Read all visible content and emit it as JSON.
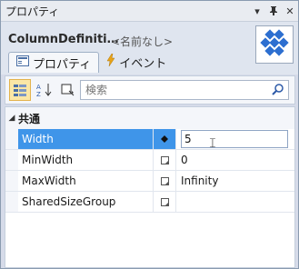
{
  "window": {
    "title": "プロパティ",
    "buttons": [
      "▾",
      "📌",
      "✕"
    ]
  },
  "header": {
    "object_name": "ColumnDefiniti…",
    "name_placeholder": "<名前なし>",
    "logo_icon": "cube-logo-icon"
  },
  "tabs": [
    {
      "label": "プロパティ",
      "icon": "property-sheet-icon",
      "active": true
    },
    {
      "label": "イベント",
      "icon": "lightning-icon",
      "active": false
    }
  ],
  "toolbar": {
    "sort_category_icon": "categorized-icon",
    "sort_alpha_icon": "alphabetical-sort-icon",
    "filter_icon": "filter-icon",
    "search_placeholder": "検索",
    "search_icon": "search-icon"
  },
  "category": {
    "name": "共通",
    "expanded": true
  },
  "properties": [
    {
      "name": "Width",
      "value": "5",
      "selected": true
    },
    {
      "name": "MinWidth",
      "value": "0",
      "selected": false
    },
    {
      "name": "MaxWidth",
      "value": "Infinity",
      "selected": false
    },
    {
      "name": "SharedSizeGroup",
      "value": "",
      "selected": false
    }
  ]
}
